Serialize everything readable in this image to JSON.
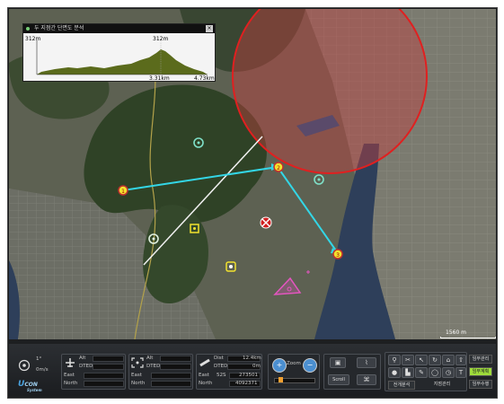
{
  "profile": {
    "title": "두 지점간 단면도 분석",
    "close": "×",
    "max_left": "312m",
    "max_peak": "312m",
    "mid_dist": "3.31km",
    "total_dist": "4.73km"
  },
  "map": {
    "waypoints": [
      "1",
      "2",
      "3"
    ],
    "scale_label": "1560 m"
  },
  "panel": {
    "wind_unit_top": "1°",
    "wind_speed": "0m/s",
    "logo_u": "U",
    "logo_rest": "CON",
    "logo_sub": "System",
    "box1": {
      "alt": "Alt",
      "dted": "DTED",
      "east": "East",
      "north": "North"
    },
    "box2": {
      "alt": "Alt",
      "dted": "DTED",
      "east": "East",
      "north": "North"
    },
    "box3": {
      "dist": "Dist",
      "dist_val": "12.4km",
      "dted": "DTED",
      "dted_val": "0m",
      "east": "East",
      "east_zone": "52S",
      "east_val": "273501",
      "north": "North",
      "north_val": "4092371"
    },
    "zoom_label": "Zoom",
    "tool1_label": "Scroll",
    "menu_analysis": "전개분석",
    "menu_center": "지점관리",
    "side_buttons": [
      "임무관리",
      "임무계획",
      "임무수행"
    ]
  },
  "colors": {
    "route": "#33d6e6",
    "circle": "#e02020",
    "marker": "#f2e22e",
    "area": "#e455c0",
    "accent_green": "#9fdc3b"
  }
}
